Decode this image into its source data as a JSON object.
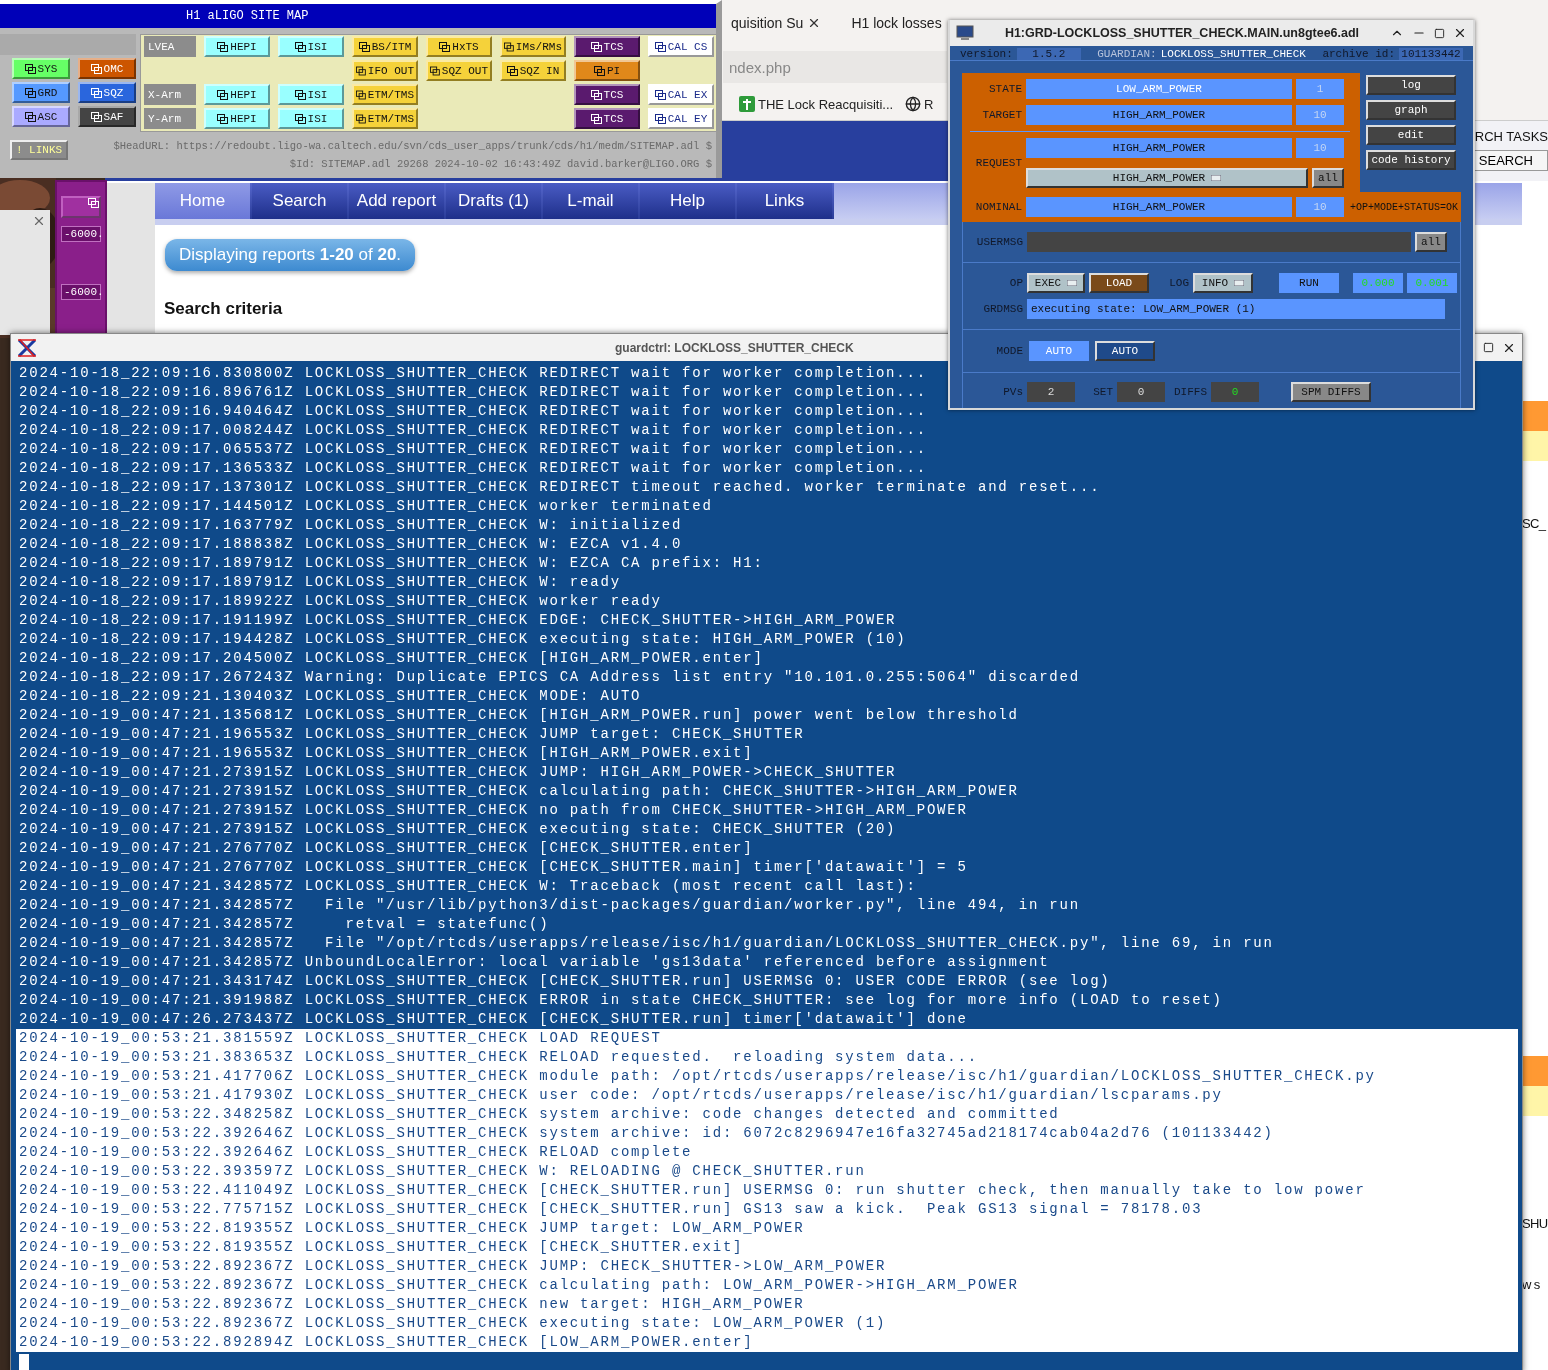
{
  "sitemap": {
    "title": "H1 aLIGO SITE MAP",
    "left_rows": [
      [],
      [
        {
          "label": "SYS",
          "color": "#66ff66"
        },
        {
          "label": "OMC",
          "color": "#cc5500"
        }
      ],
      [
        {
          "label": "GRD",
          "color": "#5599ff"
        },
        {
          "label": "SQZ",
          "color": "#2a66dd"
        }
      ],
      [
        {
          "label": "ASC",
          "color": "#aaaaff"
        },
        {
          "label": "SAF",
          "color": "#444444"
        }
      ]
    ],
    "panel_rows": [
      [
        {
          "kind": "label",
          "text": "LVEA"
        },
        {
          "kind": "button",
          "label": "HEPI",
          "color": "#99ffff"
        },
        {
          "kind": "button",
          "label": "ISI",
          "color": "#99ffff"
        },
        {
          "kind": "button",
          "label": "BS/ITM",
          "color": "#f5d23a"
        },
        {
          "kind": "button",
          "label": "HxTS",
          "color": "#f5d23a"
        },
        {
          "kind": "button",
          "label": "IMs/RMs",
          "color": "#f5d23a"
        },
        {
          "kind": "button",
          "label": "TCS",
          "color": "#5a1a6e"
        },
        {
          "kind": "button",
          "label": "CAL CS",
          "color": "#ffffff"
        }
      ],
      [
        {
          "kind": "empty"
        },
        {
          "kind": "empty"
        },
        {
          "kind": "empty"
        },
        {
          "kind": "button",
          "label": "IFO OUT",
          "color": "#f5d23a"
        },
        {
          "kind": "button",
          "label": "SQZ OUT",
          "color": "#f5d23a"
        },
        {
          "kind": "button",
          "label": "SQZ IN",
          "color": "#f5d23a"
        },
        {
          "kind": "button",
          "label": "PI",
          "color": "#e0881a"
        },
        {
          "kind": "empty"
        }
      ],
      [
        {
          "kind": "label",
          "text": "X-Arm"
        },
        {
          "kind": "button",
          "label": "HEPI",
          "color": "#99ffff"
        },
        {
          "kind": "button",
          "label": "ISI",
          "color": "#99ffff"
        },
        {
          "kind": "button",
          "label": "ETM/TMS",
          "color": "#f5d23a"
        },
        {
          "kind": "empty"
        },
        {
          "kind": "empty"
        },
        {
          "kind": "button",
          "label": "TCS",
          "color": "#5a1a6e"
        },
        {
          "kind": "button",
          "label": "CAL EX",
          "color": "#ffffff"
        }
      ],
      [
        {
          "kind": "label",
          "text": "Y-Arm"
        },
        {
          "kind": "button",
          "label": "HEPI",
          "color": "#99ffff"
        },
        {
          "kind": "button",
          "label": "ISI",
          "color": "#99ffff"
        },
        {
          "kind": "button",
          "label": "ETM/TMS",
          "color": "#f5d23a"
        },
        {
          "kind": "empty"
        },
        {
          "kind": "empty"
        },
        {
          "kind": "button",
          "label": "TCS",
          "color": "#5a1a6e"
        },
        {
          "kind": "button",
          "label": "CAL EY",
          "color": "#ffffff"
        }
      ]
    ],
    "links_button": "! LINKS",
    "head_url": "$HeadURL: https://redoubt.ligo-wa.caltech.edu/svn/cds_user_apps/trunk/cds/h1/medm/SITEMAP.adl $",
    "id_line": "$Id: SITEMAP.adl 29268 2024-10-02 16:43:49Z david.barker@LIGO.ORG $"
  },
  "left_medm": {
    "readouts": [
      "-6000.",
      "-6000."
    ]
  },
  "browser": {
    "tabs": [
      {
        "label": "quisition Su",
        "selected": false
      },
      {
        "label": "H1 lock losses",
        "selected": false
      }
    ],
    "address": "ndex.php",
    "bookmarks": [
      "THE Lock Reacquisiti...",
      "R"
    ],
    "header_right": {
      "label": "RCH TASKS",
      "button": "SEARCH"
    },
    "nav": [
      {
        "label": "Home",
        "selected": true
      },
      {
        "label": "Search",
        "selected": false
      },
      {
        "label": "Add report",
        "selected": false
      },
      {
        "label": "Drafts (1)",
        "selected": false
      },
      {
        "label": "L-mail",
        "selected": false
      },
      {
        "label": "Help",
        "selected": false
      },
      {
        "label": "Links",
        "selected": false
      }
    ],
    "results": "Displaying reports **1-20** of **20**.",
    "search_criteria": "Search criteria",
    "side_texts": [
      "SC_",
      "SHU",
      "w s"
    ]
  },
  "guardian": {
    "title": "H1:GRD-LOCKLOSS_SHUTTER_CHECK.MAIN.un8gtee6.adl",
    "version_label": "version:",
    "version": "1.5.2",
    "guardian_label": "GUARDIAN:",
    "guardian_name": "LOCKLOSS_SHUTTER_CHECK",
    "archive_label": "archive id:",
    "archive_id": "101133442",
    "state": {
      "label": "STATE",
      "value": "LOW_ARM_POWER",
      "index": "1"
    },
    "target": {
      "label": "TARGET",
      "value": "HIGH_ARM_POWER",
      "index": "10"
    },
    "request": {
      "label": "REQUEST",
      "value": "HIGH_ARM_POWER",
      "index": "10",
      "menu": "HIGH_ARM_POWER",
      "all_button": "all"
    },
    "side_buttons": [
      "log",
      "graph",
      "edit",
      "code history"
    ],
    "nominal": {
      "label": "NOMINAL",
      "value": "HIGH_ARM_POWER",
      "index": "10",
      "status": "+OP+MODE+STATUS=OK"
    },
    "usermsg": {
      "label": "USERMSG",
      "all_button": "all"
    },
    "op": {
      "label": "OP",
      "menu": "EXEC",
      "load_button": "LOAD",
      "log_label": "LOG",
      "log_menu": "INFO",
      "run": "RUN",
      "timings": [
        "0.000",
        "0.001"
      ]
    },
    "grdmsg": {
      "label": "GRDMSG",
      "text": "executing state: LOW_ARM_POWER (1)"
    },
    "mode": {
      "label": "MODE",
      "value": "AUTO",
      "button": "AUTO"
    },
    "pvs": {
      "label": "PVs",
      "value": "2",
      "set_label": "SET",
      "set_value": "0",
      "diffs_label": "DIFFS",
      "diffs_value": "0",
      "spm_button": "SPM DIFFS"
    }
  },
  "log": {
    "title": "guardctrl: LOCKLOSS_SHUTTER_CHECK",
    "lines": [
      {
        "text": "2024-10-18_22:09:16.830800Z LOCKLOSS_SHUTTER_CHECK REDIRECT wait for worker completion...",
        "selected": false
      },
      {
        "text": "2024-10-18_22:09:16.896761Z LOCKLOSS_SHUTTER_CHECK REDIRECT wait for worker completion...",
        "selected": false
      },
      {
        "text": "2024-10-18_22:09:16.940464Z LOCKLOSS_SHUTTER_CHECK REDIRECT wait for worker completion...",
        "selected": false
      },
      {
        "text": "2024-10-18_22:09:17.008244Z LOCKLOSS_SHUTTER_CHECK REDIRECT wait for worker completion...",
        "selected": false
      },
      {
        "text": "2024-10-18_22:09:17.065537Z LOCKLOSS_SHUTTER_CHECK REDIRECT wait for worker completion...",
        "selected": false
      },
      {
        "text": "2024-10-18_22:09:17.136533Z LOCKLOSS_SHUTTER_CHECK REDIRECT wait for worker completion...",
        "selected": false
      },
      {
        "text": "2024-10-18_22:09:17.137301Z LOCKLOSS_SHUTTER_CHECK REDIRECT timeout reached. worker terminate and reset...",
        "selected": false
      },
      {
        "text": "2024-10-18_22:09:17.144501Z LOCKLOSS_SHUTTER_CHECK worker terminated",
        "selected": false
      },
      {
        "text": "2024-10-18_22:09:17.163779Z LOCKLOSS_SHUTTER_CHECK W: initialized",
        "selected": false
      },
      {
        "text": "2024-10-18_22:09:17.188838Z LOCKLOSS_SHUTTER_CHECK W: EZCA v1.4.0",
        "selected": false
      },
      {
        "text": "2024-10-18_22:09:17.189791Z LOCKLOSS_SHUTTER_CHECK W: EZCA CA prefix: H1:",
        "selected": false
      },
      {
        "text": "2024-10-18_22:09:17.189791Z LOCKLOSS_SHUTTER_CHECK W: ready",
        "selected": false
      },
      {
        "text": "2024-10-18_22:09:17.189922Z LOCKLOSS_SHUTTER_CHECK worker ready",
        "selected": false
      },
      {
        "text": "2024-10-18_22:09:17.191199Z LOCKLOSS_SHUTTER_CHECK EDGE: CHECK_SHUTTER->HIGH_ARM_POWER",
        "selected": false
      },
      {
        "text": "2024-10-18_22:09:17.194428Z LOCKLOSS_SHUTTER_CHECK executing state: HIGH_ARM_POWER (10)",
        "selected": false
      },
      {
        "text": "2024-10-18_22:09:17.204500Z LOCKLOSS_SHUTTER_CHECK [HIGH_ARM_POWER.enter]",
        "selected": false
      },
      {
        "text": "2024-10-18_22:09:17.267243Z Warning: Duplicate EPICS CA Address list entry \"10.101.0.255:5064\" discarded",
        "selected": false
      },
      {
        "text": "2024-10-18_22:09:21.130403Z LOCKLOSS_SHUTTER_CHECK MODE: AUTO",
        "selected": false
      },
      {
        "text": "2024-10-19_00:47:21.135681Z LOCKLOSS_SHUTTER_CHECK [HIGH_ARM_POWER.run] power went below threshold",
        "selected": false
      },
      {
        "text": "2024-10-19_00:47:21.196553Z LOCKLOSS_SHUTTER_CHECK JUMP target: CHECK_SHUTTER",
        "selected": false
      },
      {
        "text": "2024-10-19_00:47:21.196553Z LOCKLOSS_SHUTTER_CHECK [HIGH_ARM_POWER.exit]",
        "selected": false
      },
      {
        "text": "2024-10-19_00:47:21.273915Z LOCKLOSS_SHUTTER_CHECK JUMP: HIGH_ARM_POWER->CHECK_SHUTTER",
        "selected": false
      },
      {
        "text": "2024-10-19_00:47:21.273915Z LOCKLOSS_SHUTTER_CHECK calculating path: CHECK_SHUTTER->HIGH_ARM_POWER",
        "selected": false
      },
      {
        "text": "2024-10-19_00:47:21.273915Z LOCKLOSS_SHUTTER_CHECK no path from CHECK_SHUTTER->HIGH_ARM_POWER",
        "selected": false
      },
      {
        "text": "2024-10-19_00:47:21.273915Z LOCKLOSS_SHUTTER_CHECK executing state: CHECK_SHUTTER (20)",
        "selected": false
      },
      {
        "text": "2024-10-19_00:47:21.276770Z LOCKLOSS_SHUTTER_CHECK [CHECK_SHUTTER.enter]",
        "selected": false
      },
      {
        "text": "2024-10-19_00:47:21.276770Z LOCKLOSS_SHUTTER_CHECK [CHECK_SHUTTER.main] timer['datawait'] = 5",
        "selected": false
      },
      {
        "text": "2024-10-19_00:47:21.342857Z LOCKLOSS_SHUTTER_CHECK W: Traceback (most recent call last):",
        "selected": false
      },
      {
        "text": "2024-10-19_00:47:21.342857Z   File \"/usr/lib/python3/dist-packages/guardian/worker.py\", line 494, in run",
        "selected": false
      },
      {
        "text": "2024-10-19_00:47:21.342857Z     retval = statefunc()",
        "selected": false
      },
      {
        "text": "2024-10-19_00:47:21.342857Z   File \"/opt/rtcds/userapps/release/isc/h1/guardian/LOCKLOSS_SHUTTER_CHECK.py\", line 69, in run",
        "selected": false
      },
      {
        "text": "2024-10-19_00:47:21.342857Z UnboundLocalError: local variable 'gs13data' referenced before assignment",
        "selected": false
      },
      {
        "text": "2024-10-19_00:47:21.343174Z LOCKLOSS_SHUTTER_CHECK [CHECK_SHUTTER.run] USERMSG 0: USER CODE ERROR (see log)",
        "selected": false
      },
      {
        "text": "2024-10-19_00:47:21.391988Z LOCKLOSS_SHUTTER_CHECK ERROR in state CHECK_SHUTTER: see log for more info (LOAD to reset)",
        "selected": false
      },
      {
        "text": "2024-10-19_00:47:26.273437Z LOCKLOSS_SHUTTER_CHECK [CHECK_SHUTTER.run] timer['datawait'] done",
        "selected": false
      },
      {
        "text": "2024-10-19_00:53:21.381559Z LOCKLOSS_SHUTTER_CHECK LOAD REQUEST",
        "selected": true
      },
      {
        "text": "2024-10-19_00:53:21.383653Z LOCKLOSS_SHUTTER_CHECK RELOAD requested.  reloading system data...",
        "selected": true
      },
      {
        "text": "2024-10-19_00:53:21.417706Z LOCKLOSS_SHUTTER_CHECK module path: /opt/rtcds/userapps/release/isc/h1/guardian/LOCKLOSS_SHUTTER_CHECK.py",
        "selected": true
      },
      {
        "text": "2024-10-19_00:53:21.417930Z LOCKLOSS_SHUTTER_CHECK user code: /opt/rtcds/userapps/release/isc/h1/guardian/lscparams.py",
        "selected": true
      },
      {
        "text": "2024-10-19_00:53:22.348258Z LOCKLOSS_SHUTTER_CHECK system archive: code changes detected and committed",
        "selected": true
      },
      {
        "text": "2024-10-19_00:53:22.392646Z LOCKLOSS_SHUTTER_CHECK system archive: id: 6072c8296947e16fa32745ad218174cab04a2d76 (101133442)",
        "selected": true
      },
      {
        "text": "2024-10-19_00:53:22.392646Z LOCKLOSS_SHUTTER_CHECK RELOAD complete",
        "selected": true
      },
      {
        "text": "2024-10-19_00:53:22.393597Z LOCKLOSS_SHUTTER_CHECK W: RELOADING @ CHECK_SHUTTER.run",
        "selected": true
      },
      {
        "text": "2024-10-19_00:53:22.411049Z LOCKLOSS_SHUTTER_CHECK [CHECK_SHUTTER.run] USERMSG 0: run shutter check, then manually take to low power",
        "selected": true
      },
      {
        "text": "2024-10-19_00:53:22.775715Z LOCKLOSS_SHUTTER_CHECK [CHECK_SHUTTER.run] GS13 saw a kick.  Peak GS13 signal = 78178.03",
        "selected": true
      },
      {
        "text": "2024-10-19_00:53:22.819355Z LOCKLOSS_SHUTTER_CHECK JUMP target: LOW_ARM_POWER",
        "selected": true
      },
      {
        "text": "2024-10-19_00:53:22.819355Z LOCKLOSS_SHUTTER_CHECK [CHECK_SHUTTER.exit]",
        "selected": true
      },
      {
        "text": "2024-10-19_00:53:22.892367Z LOCKLOSS_SHUTTER_CHECK JUMP: CHECK_SHUTTER->LOW_ARM_POWER",
        "selected": true
      },
      {
        "text": "2024-10-19_00:53:22.892367Z LOCKLOSS_SHUTTER_CHECK calculating path: LOW_ARM_POWER->HIGH_ARM_POWER",
        "selected": true
      },
      {
        "text": "2024-10-19_00:53:22.892367Z LOCKLOSS_SHUTTER_CHECK new target: HIGH_ARM_POWER",
        "selected": true
      },
      {
        "text": "2024-10-19_00:53:22.892367Z LOCKLOSS_SHUTTER_CHECK executing state: LOW_ARM_POWER (1)",
        "selected": true
      },
      {
        "text": "2024-10-19_00:53:22.892894Z LOCKLOSS_SHUTTER_CHECK [LOW_ARM_POWER.enter]",
        "selected": true
      }
    ]
  }
}
